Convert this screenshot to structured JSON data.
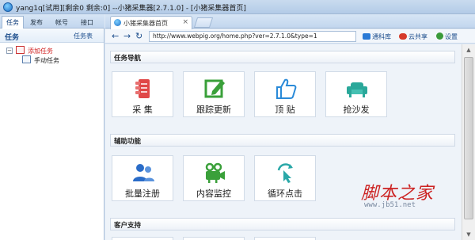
{
  "window": {
    "title": "yang1q[试用][剩余0 剩余:0] --小猪采集器[2.7.1.0] - [小猪采集器首页]"
  },
  "left_panel": {
    "tabs": [
      {
        "label": "任务",
        "active": true
      },
      {
        "label": "发布",
        "active": false
      },
      {
        "label": "帐号",
        "active": false
      },
      {
        "label": "接口",
        "active": false
      }
    ],
    "title": "任务",
    "link": "任务表",
    "tree": {
      "root": {
        "label": "添加任务",
        "expander": "−"
      },
      "children": [
        {
          "label": "手动任务"
        }
      ]
    }
  },
  "browser_tab": {
    "label": "小猪采集器首页",
    "close": "×"
  },
  "toolbar": {
    "back": "←",
    "forward": "→",
    "refresh": "↻",
    "url": "http://www.webpig.org/home.php?ver=2.7.1.0&type=1",
    "items": [
      {
        "label": "通科库",
        "icon": "download-icon",
        "color": "#2a7ad6"
      },
      {
        "label": "云共享",
        "icon": "cloud-icon",
        "color": "#d63a2a"
      },
      {
        "label": "设置",
        "icon": "settings-icon",
        "color": "#3a9a3a"
      }
    ]
  },
  "sections": [
    {
      "title": "任务导航",
      "tiles": [
        {
          "label": "采 集",
          "icon": "gather-icon",
          "color": "#e04848"
        },
        {
          "label": "跟踪更新",
          "icon": "edit-icon",
          "color": "#3aa03a"
        },
        {
          "label": "顶 贴",
          "icon": "thumbs-up-icon",
          "color": "#2a8ad8"
        },
        {
          "label": "抢沙发",
          "icon": "sofa-icon",
          "color": "#2aa89a"
        }
      ]
    },
    {
      "title": "辅助功能",
      "tiles": [
        {
          "label": "批量注册",
          "icon": "users-icon",
          "color": "#2a6cc8"
        },
        {
          "label": "内容监控",
          "icon": "camera-icon",
          "color": "#3aa03a"
        },
        {
          "label": "循环点击",
          "icon": "click-icon",
          "color": "#2aa8a8"
        }
      ]
    },
    {
      "title": "客户支持",
      "tiles": []
    }
  ],
  "watermark": {
    "main": "脚本之家",
    "url": "www.jb51.net"
  },
  "scrollbar": {
    "up": "▲",
    "down": "▼"
  }
}
